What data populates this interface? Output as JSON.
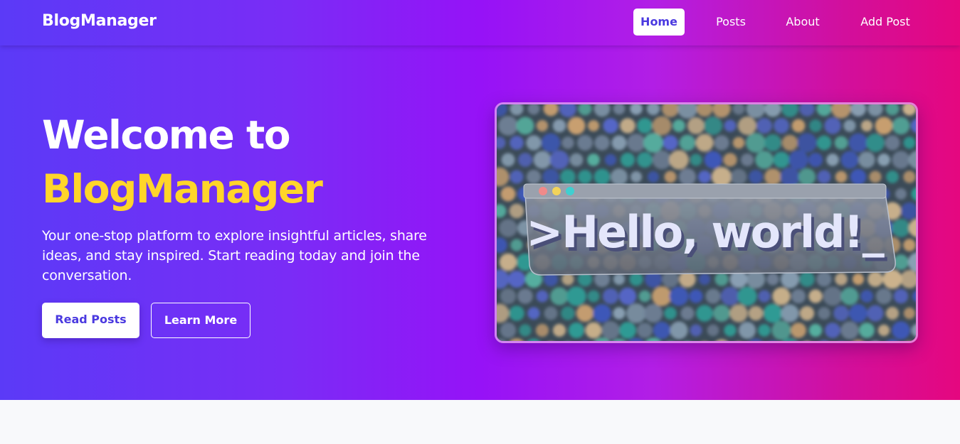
{
  "nav": {
    "brand": "BlogManager",
    "links": [
      {
        "label": "Home",
        "active": true
      },
      {
        "label": "Posts",
        "active": false
      },
      {
        "label": "About",
        "active": false
      },
      {
        "label": "Add Post",
        "active": false
      }
    ]
  },
  "hero": {
    "title_line1": "Welcome to",
    "title_line2": "BlogManager",
    "description": "Your one-stop platform to explore insightful articles, share ideas, and stay inspired. Start reading today and join the conversation.",
    "primary_button": "Read Posts",
    "secondary_button": "Learn More",
    "image": {
      "caption_text": ">Hello, world!_",
      "dot_colors": [
        "#f08a8a",
        "#f2d35a",
        "#40cfd0"
      ]
    }
  },
  "colors": {
    "accent_yellow": "#ffd52a",
    "primary_text": "#4b3ae0",
    "gradient_start": "#5b3af7",
    "gradient_mid": "#9612f7",
    "gradient_end": "#e5077f"
  }
}
